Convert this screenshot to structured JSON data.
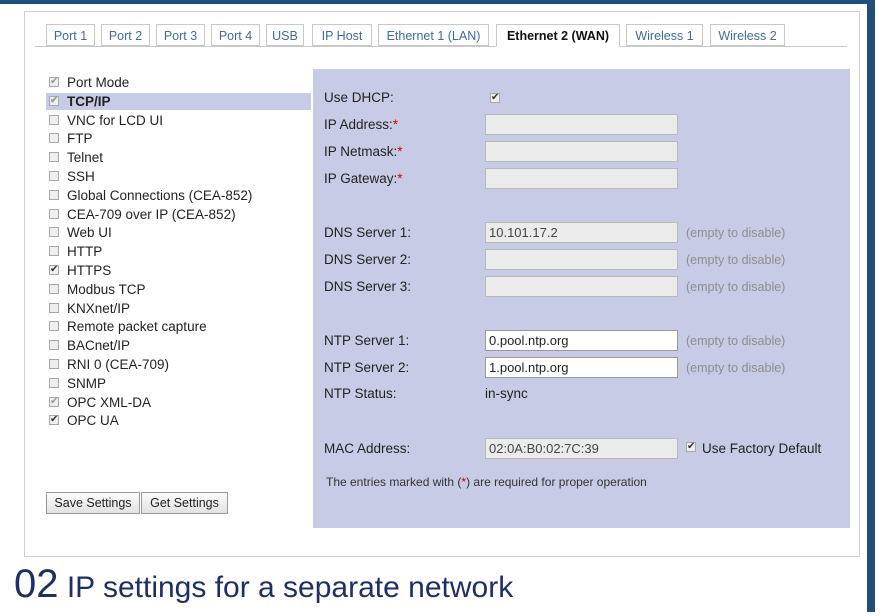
{
  "tabs": [
    "Port 1",
    "Port 2",
    "Port 3",
    "Port 4",
    "USB",
    "IP Host",
    "Ethernet 1 (LAN)",
    "Ethernet 2 (WAN)",
    "Wireless 1",
    "Wireless 2"
  ],
  "active_tab": "Ethernet 2 (WAN)",
  "sidebar": {
    "items": [
      {
        "label": "Port Mode",
        "checked": true,
        "disabled": true
      },
      {
        "label": "TCP/IP",
        "checked": true,
        "disabled": true,
        "selected": true
      },
      {
        "label": "VNC for LCD UI",
        "checked": false
      },
      {
        "label": "FTP",
        "checked": false
      },
      {
        "label": "Telnet",
        "checked": false
      },
      {
        "label": "SSH",
        "checked": false
      },
      {
        "label": "Global Connections (CEA-852)",
        "checked": false
      },
      {
        "label": "CEA-709 over IP (CEA-852)",
        "checked": false
      },
      {
        "label": "Web UI",
        "checked": false
      },
      {
        "label": "HTTP",
        "checked": false
      },
      {
        "label": "HTTPS",
        "checked": true
      },
      {
        "label": "Modbus TCP",
        "checked": false
      },
      {
        "label": "KNXnet/IP",
        "checked": false
      },
      {
        "label": "Remote packet capture",
        "checked": false
      },
      {
        "label": "BACnet/IP",
        "checked": false
      },
      {
        "label": "RNI 0 (CEA-709)",
        "checked": false
      },
      {
        "label": "SNMP",
        "checked": false
      },
      {
        "label": "OPC XML-DA",
        "checked": true,
        "disabled": true
      },
      {
        "label": "OPC UA",
        "checked": true
      }
    ],
    "save_label": "Save Settings",
    "get_label": "Get Settings"
  },
  "form": {
    "use_dhcp": {
      "label": "Use DHCP:",
      "checked": true
    },
    "ip_address": {
      "label": "IP Address:",
      "value": ""
    },
    "ip_netmask": {
      "label": "IP Netmask:",
      "value": ""
    },
    "ip_gateway": {
      "label": "IP Gateway:",
      "value": ""
    },
    "required_mark": "*",
    "dns1": {
      "label": "DNS Server 1:",
      "value": "10.101.17.2",
      "hint": "(empty to disable)"
    },
    "dns2": {
      "label": "DNS Server 2:",
      "value": "",
      "hint": "(empty to disable)"
    },
    "dns3": {
      "label": "DNS Server 3:",
      "value": "",
      "hint": "(empty to disable)"
    },
    "ntp1": {
      "label": "NTP Server 1:",
      "value": "0.pool.ntp.org",
      "hint": "(empty to disable)"
    },
    "ntp2": {
      "label": "NTP Server 2:",
      "value": "1.pool.ntp.org",
      "hint": "(empty to disable)"
    },
    "ntp_status": {
      "label": "NTP Status:",
      "value": "in-sync"
    },
    "mac": {
      "label": "MAC Address:",
      "value": "02:0A:B0:02:7C:39",
      "factory_label": "Use Factory Default",
      "factory_checked": true
    },
    "footnote_pre": "The entries marked with (",
    "footnote_mark": "*",
    "footnote_post": ") are required for proper operation"
  },
  "caption": {
    "number": "02",
    "text": " IP settings for a separate network"
  },
  "colors": {
    "frame": "#1f4f7a",
    "selection": "#c7cbe6",
    "caption": "#1e2e66",
    "required": "#dd0000",
    "tab_link": "#3d6aa5"
  }
}
